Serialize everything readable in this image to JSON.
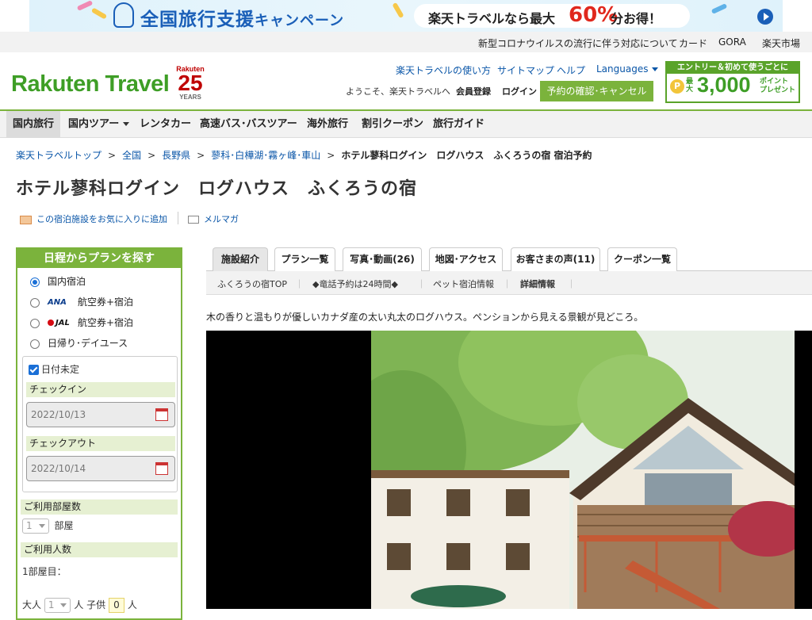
{
  "banner": {
    "title": "全国旅行支援",
    "title_suffix": "キャンペーン",
    "pill_text": "楽天トラベルなら最大",
    "pill_big": "60%",
    "pill_rest": "分お得！"
  },
  "utility": {
    "links": [
      "新型コロナウイルスの流行に伴う対応について",
      "カード",
      "GORA",
      "楽天市場"
    ]
  },
  "header": {
    "logo": "Rakuten Travel",
    "anniv_brand": "Rakuten",
    "anniv_num": "25",
    "anniv_years": "YEARS",
    "links": [
      "楽天トラベルの使い方",
      "サイトマップ",
      "ヘルプ",
      "Languages"
    ],
    "welcome": "ようこそ、楽天トラベルへ",
    "register": "会員登録",
    "login": "ログイン",
    "reserve_button": "予約の確認･キャンセル",
    "promo_head": "エントリー＆初めて使うごとに",
    "promo_coin": "P",
    "promo_small1": "最大",
    "promo_num": "3,000",
    "promo_small2": "ポイント\nプレゼント"
  },
  "gnav": {
    "items": [
      "国内旅行",
      "国内ツアー",
      "レンタカー",
      "高速バス･バスツアー",
      "海外旅行",
      "割引クーポン",
      "旅行ガイド"
    ]
  },
  "breadcrumb": {
    "items": [
      "楽天トラベルトップ",
      "全国",
      "長野県",
      "蓼科･白樺湖･霧ヶ峰･車山"
    ],
    "current": "ホテル蓼科ログイン　ログハウス　ふくろうの宿 宿泊予約",
    "separator": ">"
  },
  "page_title": "ホテル蓼科ログイン　ログハウス　ふくろうの宿",
  "actions": {
    "favorite": "この宿泊施設をお気に入りに追加",
    "mailmag": "メルマガ"
  },
  "sidebar": {
    "title": "日程からプランを探す",
    "options": [
      {
        "logo": "",
        "label": "国内宿泊",
        "selected": true
      },
      {
        "logo": "ANA",
        "label": "航空券+宿泊",
        "selected": false
      },
      {
        "logo": "JAL",
        "label": "航空券+宿泊",
        "selected": false
      },
      {
        "logo": "",
        "label": "日帰り･デイユース",
        "selected": false
      }
    ],
    "undecided": "日付未定",
    "checkin_label": "チェックイン",
    "checkin_value": "2022/10/13",
    "checkout_label": "チェックアウト",
    "checkout_value": "2022/10/14",
    "rooms_label": "ご利用部屋数",
    "rooms_value": "1",
    "rooms_unit": "部屋",
    "people_label": "ご利用人数",
    "room1": "1部屋目：",
    "adult_label": "大人",
    "adult_value": "1",
    "adult_unit": "人",
    "child_label": "子供",
    "child_value": "0",
    "child_unit": "人"
  },
  "tabs": {
    "items": [
      "施設紹介",
      "プラン一覧",
      "写真･動画(26)",
      "地図･アクセス",
      "お客さまの声(11)",
      "クーポン一覧"
    ]
  },
  "subnav": {
    "items": [
      "ふくろうの宿TOP",
      "◆竜話予約は24時間◆",
      "ペット宿泊情報",
      "詳細情報"
    ],
    "separator": "｜"
  },
  "description": "木の香りと温もりが優しいカナダ産の太い丸太のログハウス。ペンションから見える景観が見どころ。",
  "colors": {
    "brand_green": "#7bb33c",
    "logo_green": "#3e9e26",
    "link_blue": "#0a56a8",
    "banner_blue": "#1a5fb8",
    "accent_red": "#e0281d"
  }
}
